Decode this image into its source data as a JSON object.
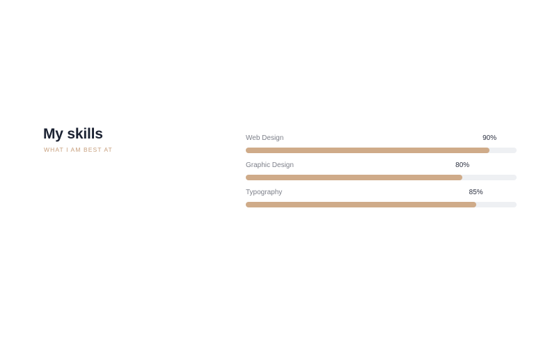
{
  "header": {
    "title": "My skills",
    "subtitle": "WHAT I AM BEST AT"
  },
  "colors": {
    "accent": "#cfab89",
    "track": "#eef0f3",
    "title": "#1c2333"
  },
  "skills": [
    {
      "label": "Web Design",
      "value_text": "90%",
      "percent": 90
    },
    {
      "label": "Graphic Design",
      "value_text": "80%",
      "percent": 80
    },
    {
      "label": "Typography",
      "value_text": "85%",
      "percent": 85
    }
  ]
}
